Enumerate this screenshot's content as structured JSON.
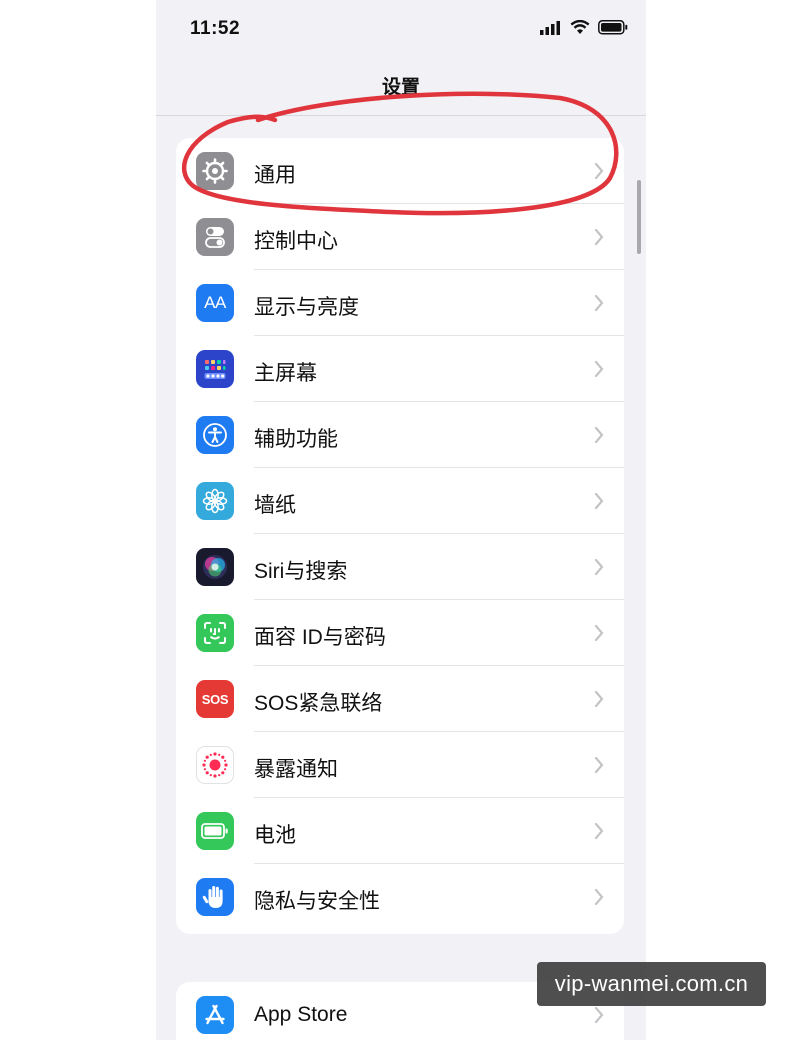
{
  "status_bar": {
    "time": "11:52"
  },
  "nav": {
    "title": "设置"
  },
  "settings_group_1": [
    {
      "label": "通用",
      "icon": "gear-icon",
      "color": "#8e8e93"
    },
    {
      "label": "控制中心",
      "icon": "toggle-switches-icon",
      "color": "#8e8e93"
    },
    {
      "label": "显示与亮度",
      "icon": "text-size-aa-icon",
      "color": "#1e7bf2"
    },
    {
      "label": "主屏幕",
      "icon": "home-screen-grid-icon",
      "color": "#2b44c9"
    },
    {
      "label": "辅助功能",
      "icon": "accessibility-person-icon",
      "color": "#1e7bf2"
    },
    {
      "label": "墙纸",
      "icon": "flower-icon",
      "color": "#34aadc"
    },
    {
      "label": "Siri与搜索",
      "icon": "siri-orb-icon",
      "color": "#1a1a2e"
    },
    {
      "label": "面容 ID与密码",
      "icon": "face-id-icon",
      "color": "#34c759"
    },
    {
      "label": "SOS紧急联络",
      "icon": "sos-icon",
      "color": "#e53935"
    },
    {
      "label": "暴露通知",
      "icon": "exposure-dots-icon",
      "color": "#ffffff"
    },
    {
      "label": "电池",
      "icon": "battery-icon",
      "color": "#34c759"
    },
    {
      "label": "隐私与安全性",
      "icon": "hand-icon",
      "color": "#1e7bf2"
    }
  ],
  "settings_group_2": [
    {
      "label": "App Store",
      "icon": "app-store-icon",
      "color": "#1e8ef5"
    }
  ],
  "icon_text": {
    "aa": "AA",
    "sos": "SOS"
  },
  "annotation": {
    "color": "#e0353c"
  },
  "watermark": {
    "text": "vip-wanmei.com.cn"
  }
}
